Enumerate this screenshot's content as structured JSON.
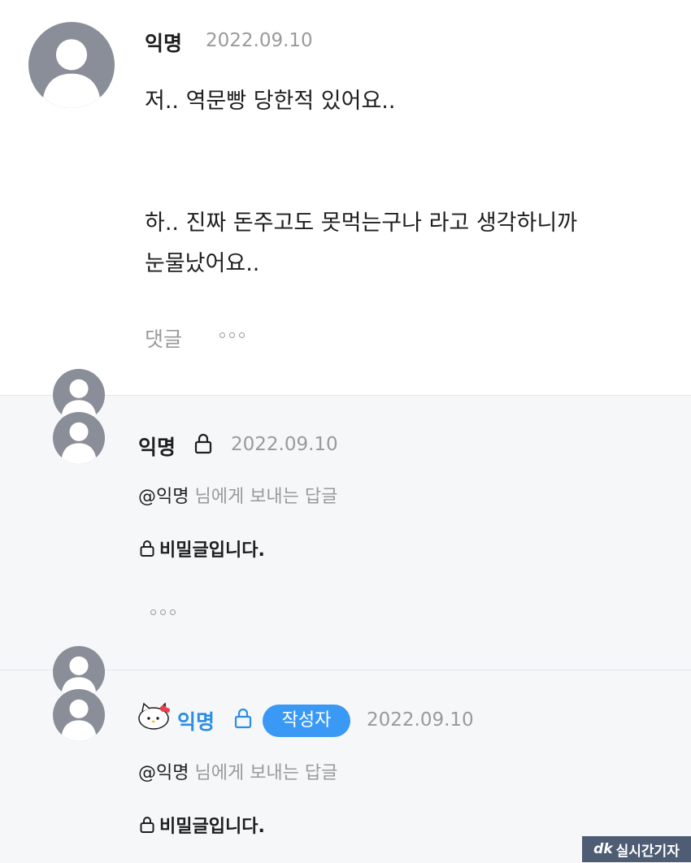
{
  "comment": {
    "author": "익명",
    "date": "2022.09.10",
    "lines": [
      "저.. 역문빵 당한적 있어요..",
      "",
      "하.. 진짜 돈주고도 못먹는구나 라고 생각하니까",
      "눈물났어요.."
    ],
    "reply_label": "댓글"
  },
  "replies": [
    {
      "author": "익명",
      "date": "2022.09.10",
      "mention_name": "@익명",
      "mention_suffix": " 님에게 보내는 답글",
      "secret_text": "비밀글입니다."
    },
    {
      "author": "익명",
      "badge": "작성자",
      "date": "2022.09.10",
      "mention_name": "@익명",
      "mention_suffix": " 님에게 보내는 답글",
      "secret_text": "비밀글입니다."
    }
  ],
  "watermark": {
    "text": "실시간기자",
    "logo": "dk"
  },
  "colors": {
    "accent": "#3a99f5",
    "author_writer": "#2b8ee6",
    "avatar": "#8a8e99",
    "reply_bg": "#f6f7f9"
  }
}
